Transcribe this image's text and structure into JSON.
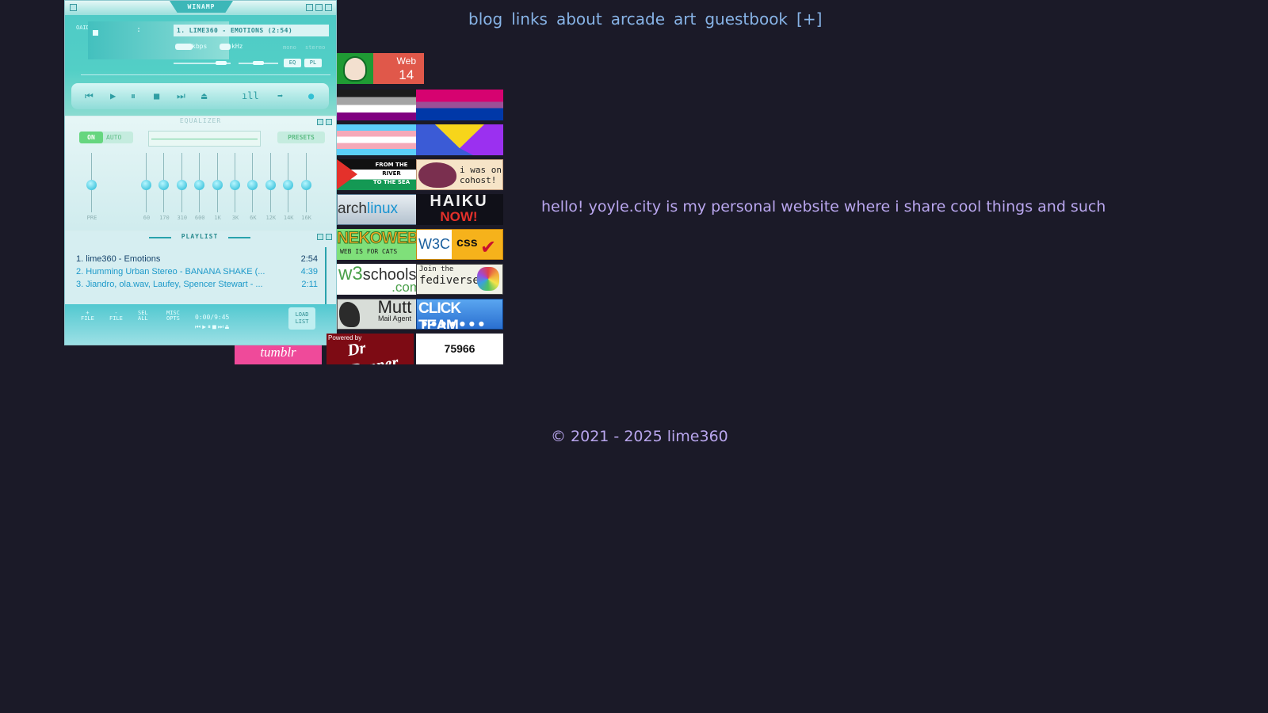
{
  "nav": {
    "items": [
      "blog",
      "links",
      "about",
      "arcade",
      "art",
      "guestbook",
      "[+]"
    ]
  },
  "welcome": "hello! yoyle.city is my personal website where i share cool things and such",
  "footer": "© 2021 - 2025 lime360",
  "winamp": {
    "title": "WINAMP",
    "side_letters": "OAIDV",
    "time_colon": ":",
    "song_display": "1. LIME360 - EMOTIONS (2:54)",
    "kbps_label": "kbps",
    "khz_label": "kHz",
    "mono_label": "mono",
    "stereo_label": "stereo",
    "eq_button": "EQ",
    "pl_button": "PL",
    "controls": {
      "prev": "⏮",
      "play": "▶",
      "pause": "⏸",
      "stop": "■",
      "next": "⏭",
      "eject": "⏏",
      "vis": "ıll",
      "repeat": "➡",
      "shuffle": "●"
    },
    "equalizer": {
      "title": "EQUALIZER",
      "on": "ON",
      "auto": "AUTO",
      "presets": "PRESETS",
      "bands": [
        "PRE",
        "60",
        "170",
        "310",
        "600",
        "1K",
        "3K",
        "6K",
        "12K",
        "14K",
        "16K"
      ]
    },
    "playlist": {
      "title": "PLAYLIST",
      "tracks": [
        {
          "title": "1. lime360 - Emotions",
          "length": "2:54"
        },
        {
          "title": "2. Humming Urban Stereo - BANANA SHAKE (...",
          "length": "4:39"
        },
        {
          "title": "3. Jiandro, ola.wav, Laufey, Spencer Stewart - ...",
          "length": "2:11"
        }
      ],
      "buttons": {
        "add": "+\nFILE",
        "rem": "-\nFILE",
        "sel": "SEL\nALL",
        "misc": "MISC\nOPTS",
        "list": "LOAD\nLIST"
      },
      "time": "0:00/9:45",
      "mini_controls": "⏮▶⏸■⏭⏏"
    }
  },
  "badges": {
    "web14": {
      "top": "Web",
      "bottom": "14"
    },
    "river": {
      "l1": "FROM THE",
      "l2": "RIVER",
      "l3": "TO THE SEA"
    },
    "cohost": "i was on cohost!",
    "arch": {
      "a": "arch",
      "b": "linux"
    },
    "haiku": {
      "t1": "HAIKU",
      "t2": "NOW!"
    },
    "neko": {
      "t1": "NEKOWEB",
      "t2": "WEB IS FOR CATS"
    },
    "w3c": {
      "w3c": "W3C",
      "css": "css",
      "check": "✔"
    },
    "w3s": {
      "w3": "w3",
      "schools": "schools",
      "com": ".com"
    },
    "fedi": {
      "t1": "Join the",
      "t2": "fediverse!!!"
    },
    "mutt": {
      "t1": "Mutt",
      "t2": "Mail Agent"
    },
    "click": {
      "t1": "CLICK TEAM",
      "dots": "●●●●●●●"
    },
    "pepper": {
      "by": "Powered by",
      "name": "Dr Pepper"
    },
    "counter": "75966",
    "pink": "tumblr"
  }
}
